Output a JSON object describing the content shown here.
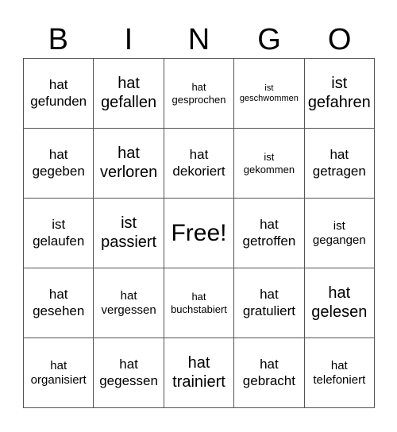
{
  "header": [
    "B",
    "I",
    "N",
    "G",
    "O"
  ],
  "cells": [
    {
      "text": "hat\ngefunden",
      "size": "l"
    },
    {
      "text": "hat\ngefallen",
      "size": "xl"
    },
    {
      "text": "hat\ngesprochen",
      "size": "s"
    },
    {
      "text": "ist\ngeschwommen",
      "size": "xs"
    },
    {
      "text": "ist\ngefahren",
      "size": "xl"
    },
    {
      "text": "hat\ngegeben",
      "size": "l"
    },
    {
      "text": "hat\nverloren",
      "size": "xl"
    },
    {
      "text": "hat\ndekoriert",
      "size": "l"
    },
    {
      "text": "ist\ngekommen",
      "size": "s"
    },
    {
      "text": "hat\ngetragen",
      "size": "l"
    },
    {
      "text": "ist\ngelaufen",
      "size": "l"
    },
    {
      "text": "ist\npassiert",
      "size": "xl"
    },
    {
      "text": "Free!",
      "size": "free"
    },
    {
      "text": "hat\ngetroffen",
      "size": "l"
    },
    {
      "text": "ist\ngegangen",
      "size": "m"
    },
    {
      "text": "hat\ngesehen",
      "size": "l"
    },
    {
      "text": "hat\nvergessen",
      "size": "m"
    },
    {
      "text": "hat\nbuchstabiert",
      "size": "s"
    },
    {
      "text": "hat\ngratuliert",
      "size": "l"
    },
    {
      "text": "hat\ngelesen",
      "size": "xl"
    },
    {
      "text": "hat\norganisiert",
      "size": "m"
    },
    {
      "text": "hat\ngegessen",
      "size": "l"
    },
    {
      "text": "hat\ntrainiert",
      "size": "xl"
    },
    {
      "text": "hat\ngebracht",
      "size": "l"
    },
    {
      "text": "hat\ntelefoniert",
      "size": "m"
    }
  ]
}
